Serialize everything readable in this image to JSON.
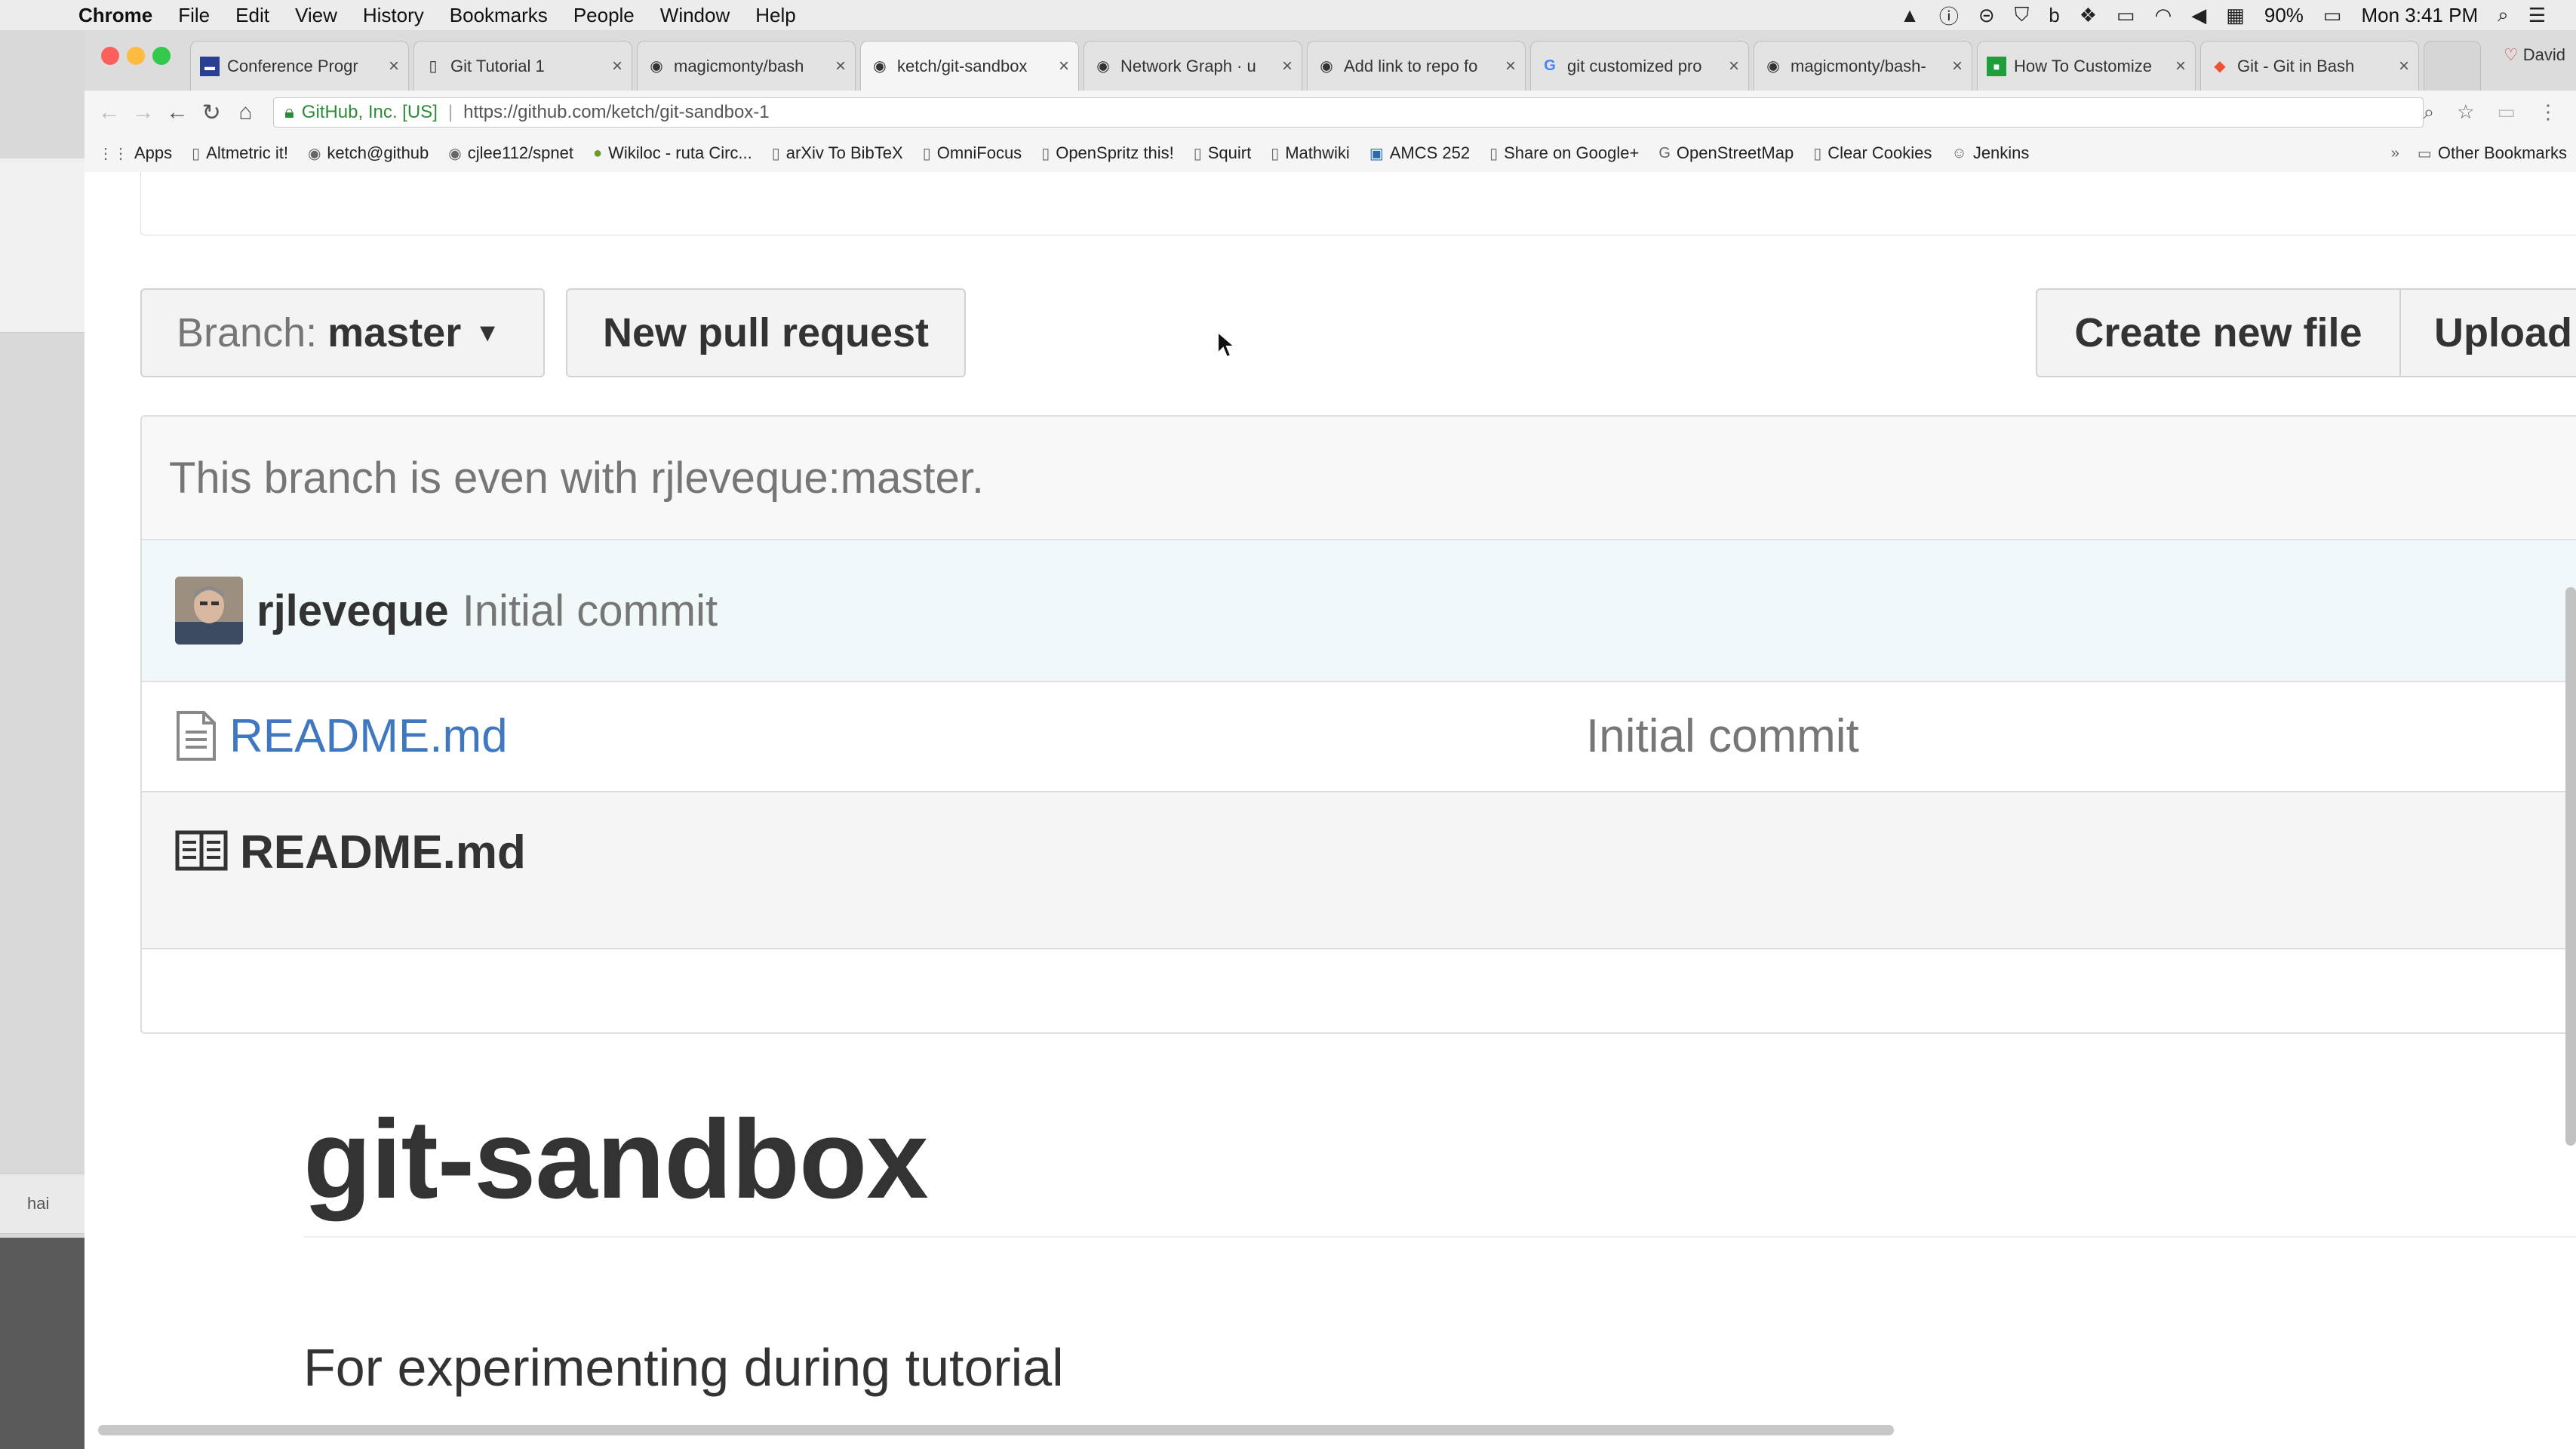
{
  "menubar": {
    "app": "Chrome",
    "menus": [
      "File",
      "Edit",
      "View",
      "History",
      "Bookmarks",
      "People",
      "Window",
      "Help"
    ],
    "battery": "90%",
    "clock": "Mon 3:41 PM"
  },
  "tabs": [
    {
      "title": "Conference Progr",
      "icon": "conference-favicon"
    },
    {
      "title": "Git Tutorial 1",
      "icon": "page-icon"
    },
    {
      "title": "magicmonty/bash",
      "icon": "github-icon"
    },
    {
      "title": "ketch/git-sandbox",
      "icon": "github-icon",
      "active": true
    },
    {
      "title": "Network Graph · u",
      "icon": "github-icon"
    },
    {
      "title": "Add link to repo fo",
      "icon": "github-icon"
    },
    {
      "title": "git customized pro",
      "icon": "google-icon"
    },
    {
      "title": "magicmonty/bash-",
      "icon": "github-icon"
    },
    {
      "title": "How To Customize",
      "icon": "green-favicon"
    },
    {
      "title": "Git - Git in Bash",
      "icon": "git-icon"
    }
  ],
  "profile": "David",
  "address": {
    "org": "GitHub, Inc. [US]",
    "url": "https://github.com/ketch/git-sandbox-1"
  },
  "bookmarks": [
    "Apps",
    "Altmetric it!",
    "ketch@github",
    "cjlee112/spnet",
    "Wikiloc - ruta Circ...",
    "arXiv To BibTeX",
    "OmniFocus",
    "OpenSpritz this!",
    "Squirt",
    "Mathwiki",
    "AMCS 252",
    "Share on Google+",
    "OpenStreetMap",
    "Clear Cookies",
    "Jenkins"
  ],
  "other_bookmarks": "Other Bookmarks",
  "repo": {
    "branch_label": "Branch:",
    "branch_name": "master",
    "new_pr": "New pull request",
    "create_file": "Create new file",
    "upload": "Upload",
    "branch_status": "This branch is even with rjleveque:master.",
    "commit_author": "rjleveque",
    "commit_message": "Initial commit",
    "files": [
      {
        "name": "README.md",
        "commit": "Initial commit"
      }
    ],
    "readme_title": "README.md",
    "readme_h1": "git-sandbox",
    "readme_text": "For experimenting during tutorial"
  },
  "desktop": {
    "thumb_label": "hai"
  },
  "colors": {
    "link": "#4078c0",
    "muted": "#767676",
    "commit_bg": "#f1f8fa",
    "secure_green": "#2e8b3a"
  }
}
